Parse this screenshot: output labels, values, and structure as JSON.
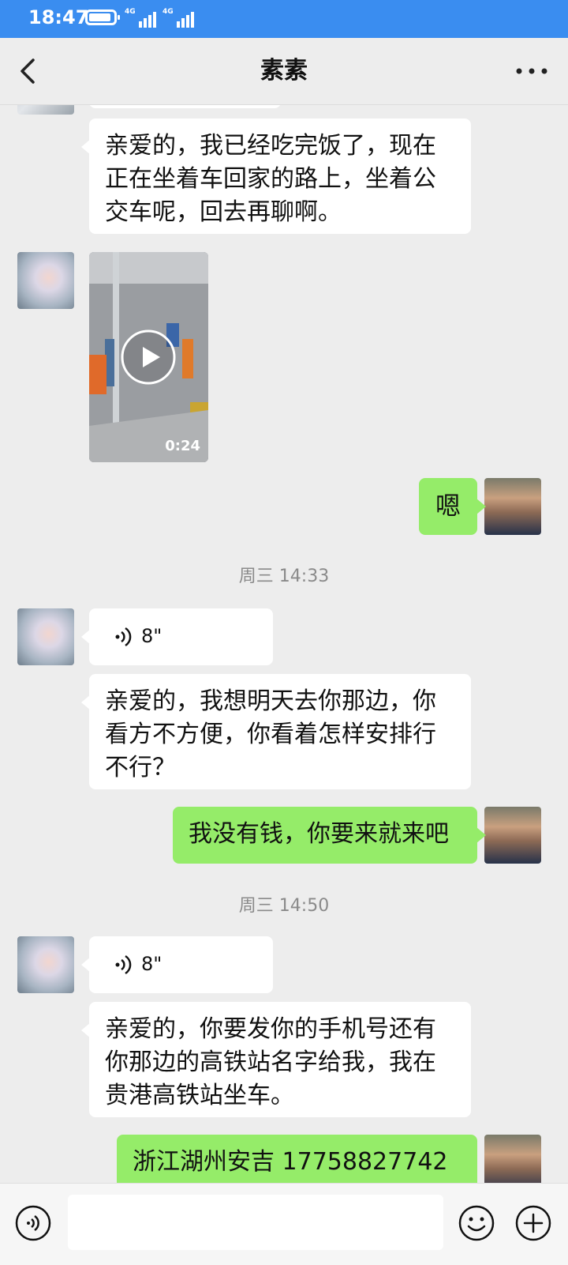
{
  "status_bar": {
    "time": "18:47",
    "network_1": "4G",
    "network_2": "4G"
  },
  "header": {
    "title": "素素",
    "back_icon": "chevron-left-icon",
    "more_icon": "more-dots-icon"
  },
  "messages": [
    {
      "side": "left",
      "type": "text",
      "text": "亲爱的，我已经吃完饭了，现在正在坐着车回家的路上，坐着公交车呢，回去再聊啊。"
    },
    {
      "side": "left",
      "type": "video",
      "duration": "0:24"
    },
    {
      "side": "right",
      "type": "text",
      "text": "嗯"
    },
    {
      "type": "timestamp",
      "text": "周三 14:33"
    },
    {
      "side": "left",
      "type": "voice",
      "duration": "8\""
    },
    {
      "side": "left",
      "type": "text",
      "text": "亲爱的，我想明天去你那边，你看方不方便，你看着怎样安排行不行？"
    },
    {
      "side": "right",
      "type": "text",
      "text": "我没有钱，你要来就来吧"
    },
    {
      "type": "timestamp",
      "text": "周三 14:50"
    },
    {
      "side": "left",
      "type": "voice",
      "duration": "8\""
    },
    {
      "side": "left",
      "type": "text",
      "text": "亲爱的，你要发你的手机号还有你那边的高铁站名字给我，我在贵港高铁站坐车。"
    },
    {
      "side": "right",
      "type": "text",
      "text": "浙江湖州安吉  17758827742"
    }
  ],
  "input_bar": {
    "voice_icon": "voice-input-icon",
    "emoji_icon": "emoji-icon",
    "add_icon": "plus-circle-icon",
    "placeholder": ""
  },
  "colors": {
    "status_bar": "#3a8df0",
    "background": "#ededed",
    "bubble_out": "#95ec69",
    "bubble_in": "#ffffff"
  }
}
